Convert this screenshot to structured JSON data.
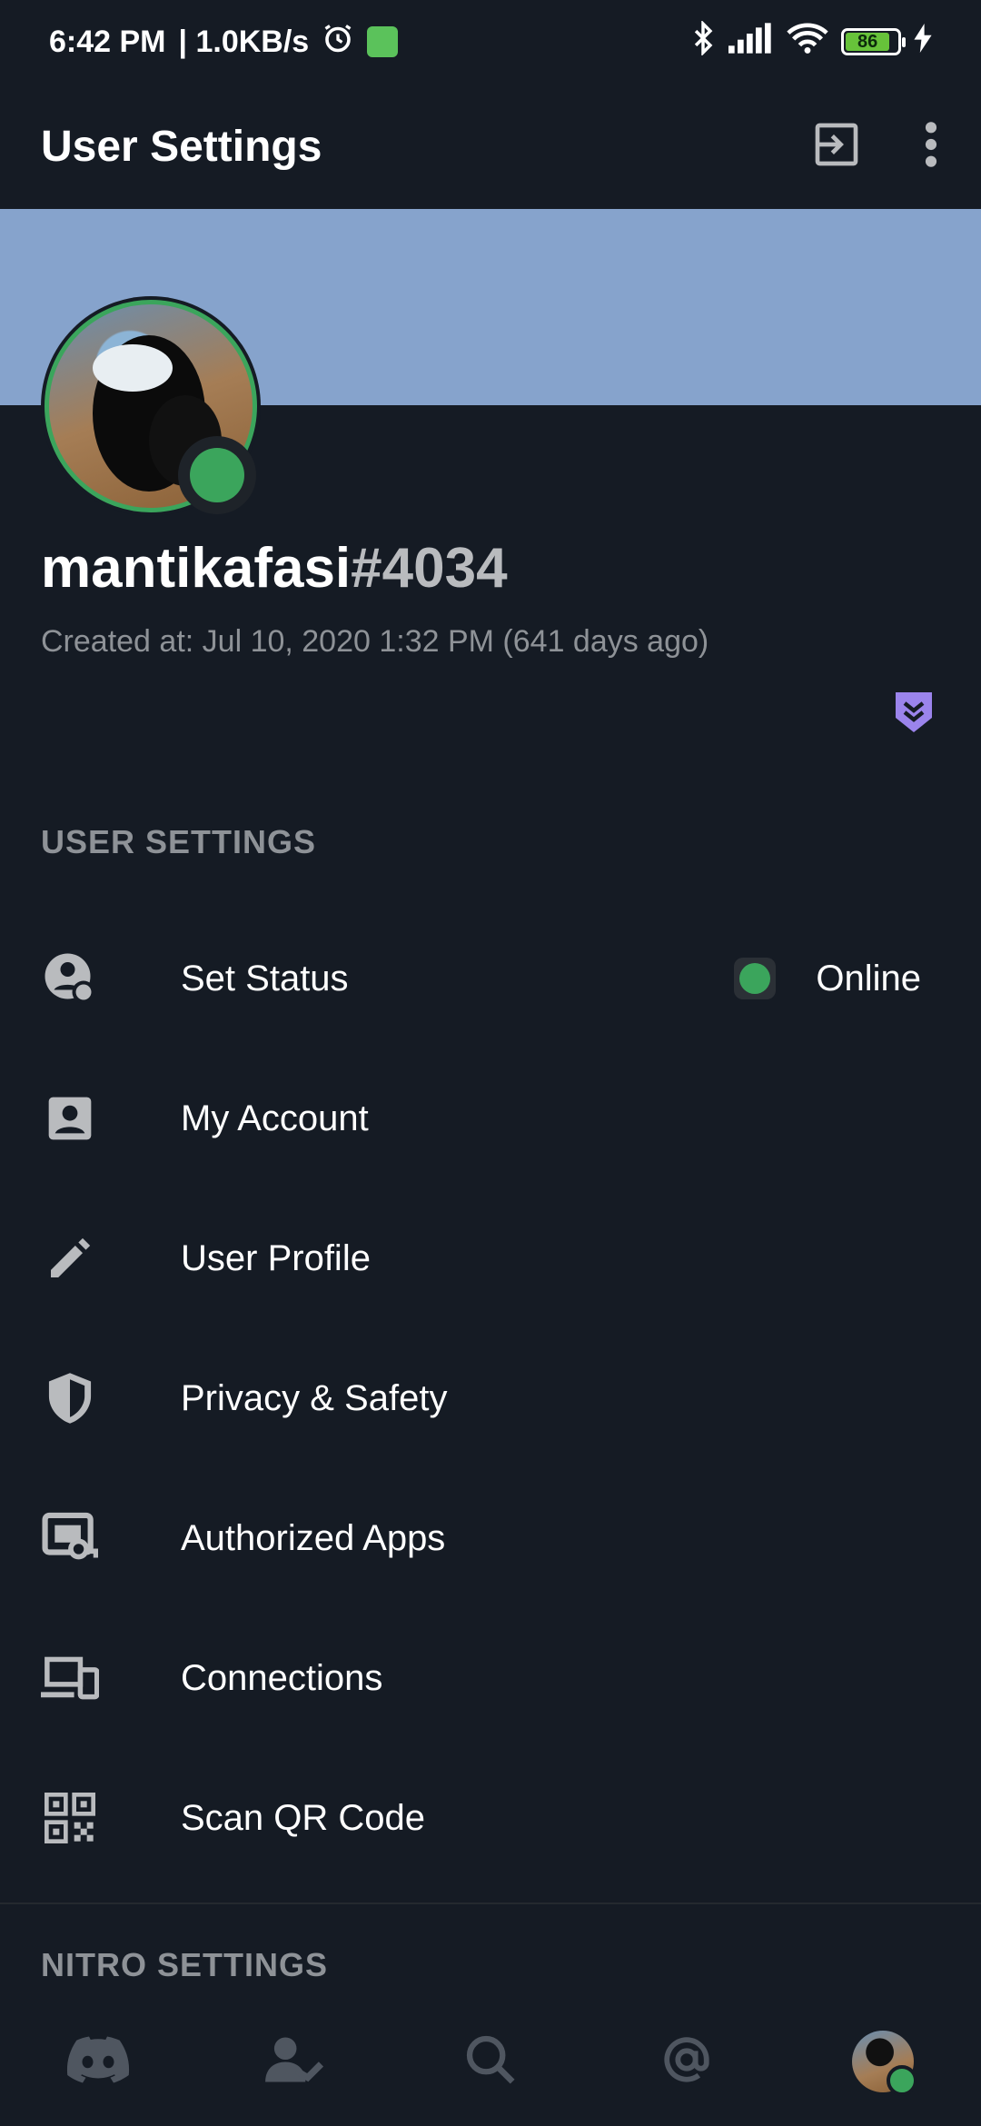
{
  "status_bar": {
    "time": "6:42 PM",
    "network_speed": "| 1.0KB/s",
    "battery": "86"
  },
  "app_bar": {
    "title": "User Settings"
  },
  "profile": {
    "username": "mantikafasi",
    "discriminator": "#4034",
    "created": "Created at: Jul 10, 2020 1:32 PM (641 days ago)",
    "status_color": "#3ba55c",
    "banner_color": "#86a3cc"
  },
  "sections": {
    "user_settings": "USER SETTINGS",
    "nitro_settings": "NITRO SETTINGS"
  },
  "settings": [
    {
      "label": "Set Status",
      "icon": "status-icon",
      "trailing": "Online"
    },
    {
      "label": "My Account",
      "icon": "account-icon"
    },
    {
      "label": "User Profile",
      "icon": "pencil-icon"
    },
    {
      "label": "Privacy & Safety",
      "icon": "shield-icon"
    },
    {
      "label": "Authorized Apps",
      "icon": "apps-icon"
    },
    {
      "label": "Connections",
      "icon": "devices-icon"
    },
    {
      "label": "Scan QR Code",
      "icon": "qr-code-icon"
    }
  ],
  "bottom_nav": [
    "discord-home-icon",
    "friends-icon",
    "search-icon",
    "mentions-icon",
    "profile-avatar"
  ]
}
